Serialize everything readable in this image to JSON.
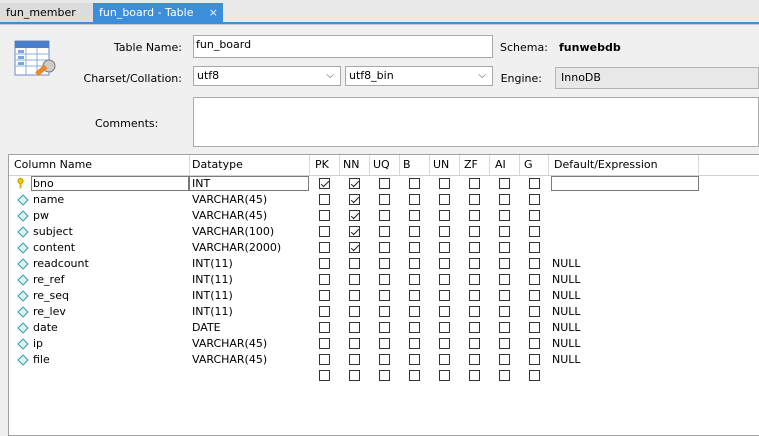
{
  "tabs": [
    {
      "label": "fun_member",
      "active": false
    },
    {
      "label": "fun_board - Table",
      "active": true
    }
  ],
  "close_glyph": "×",
  "form": {
    "table_name_label": "Table Name:",
    "table_name_value": "fun_board",
    "schema_label": "Schema:",
    "schema_value": "funwebdb",
    "charset_label": "Charset/Collation:",
    "charset_value": "utf8",
    "collation_value": "utf8_bin",
    "engine_label": "Engine:",
    "engine_value": "InnoDB",
    "comments_label": "Comments:",
    "comments_value": ""
  },
  "grid": {
    "headers": [
      "Column Name",
      "Datatype",
      "PK",
      "NN",
      "UQ",
      "B",
      "UN",
      "ZF",
      "AI",
      "G",
      "Default/Expression"
    ],
    "rows": [
      {
        "name": "bno",
        "type": "INT",
        "pk": true,
        "nn": true,
        "uq": false,
        "b": false,
        "un": false,
        "zf": false,
        "ai": false,
        "g": false,
        "default": "",
        "key": true
      },
      {
        "name": "name",
        "type": "VARCHAR(45)",
        "pk": false,
        "nn": true,
        "uq": false,
        "b": false,
        "un": false,
        "zf": false,
        "ai": false,
        "g": false,
        "default": ""
      },
      {
        "name": "pw",
        "type": "VARCHAR(45)",
        "pk": false,
        "nn": true,
        "uq": false,
        "b": false,
        "un": false,
        "zf": false,
        "ai": false,
        "g": false,
        "default": ""
      },
      {
        "name": "subject",
        "type": "VARCHAR(100)",
        "pk": false,
        "nn": true,
        "uq": false,
        "b": false,
        "un": false,
        "zf": false,
        "ai": false,
        "g": false,
        "default": ""
      },
      {
        "name": "content",
        "type": "VARCHAR(2000)",
        "pk": false,
        "nn": true,
        "uq": false,
        "b": false,
        "un": false,
        "zf": false,
        "ai": false,
        "g": false,
        "default": ""
      },
      {
        "name": "readcount",
        "type": "INT(11)",
        "pk": false,
        "nn": false,
        "uq": false,
        "b": false,
        "un": false,
        "zf": false,
        "ai": false,
        "g": false,
        "default": "NULL"
      },
      {
        "name": "re_ref",
        "type": "INT(11)",
        "pk": false,
        "nn": false,
        "uq": false,
        "b": false,
        "un": false,
        "zf": false,
        "ai": false,
        "g": false,
        "default": "NULL"
      },
      {
        "name": "re_seq",
        "type": "INT(11)",
        "pk": false,
        "nn": false,
        "uq": false,
        "b": false,
        "un": false,
        "zf": false,
        "ai": false,
        "g": false,
        "default": "NULL"
      },
      {
        "name": "re_lev",
        "type": "INT(11)",
        "pk": false,
        "nn": false,
        "uq": false,
        "b": false,
        "un": false,
        "zf": false,
        "ai": false,
        "g": false,
        "default": "NULL"
      },
      {
        "name": "date",
        "type": "DATE",
        "pk": false,
        "nn": false,
        "uq": false,
        "b": false,
        "un": false,
        "zf": false,
        "ai": false,
        "g": false,
        "default": "NULL"
      },
      {
        "name": "ip",
        "type": "VARCHAR(45)",
        "pk": false,
        "nn": false,
        "uq": false,
        "b": false,
        "un": false,
        "zf": false,
        "ai": false,
        "g": false,
        "default": "NULL"
      },
      {
        "name": "file",
        "type": "VARCHAR(45)",
        "pk": false,
        "nn": false,
        "uq": false,
        "b": false,
        "un": false,
        "zf": false,
        "ai": false,
        "g": false,
        "default": "NULL"
      },
      {
        "name": "",
        "type": "",
        "pk": false,
        "nn": false,
        "uq": false,
        "b": false,
        "un": false,
        "zf": false,
        "ai": false,
        "g": false,
        "default": "",
        "empty": true
      }
    ]
  },
  "colors": {
    "tab_active": "#3c8dda",
    "column_icon": "#2b9bb0",
    "key_icon": "#e6b800"
  },
  "icons": {
    "table_editor": "table-editor-icon",
    "column": "column-diamond-icon",
    "primary_key": "key-icon"
  }
}
